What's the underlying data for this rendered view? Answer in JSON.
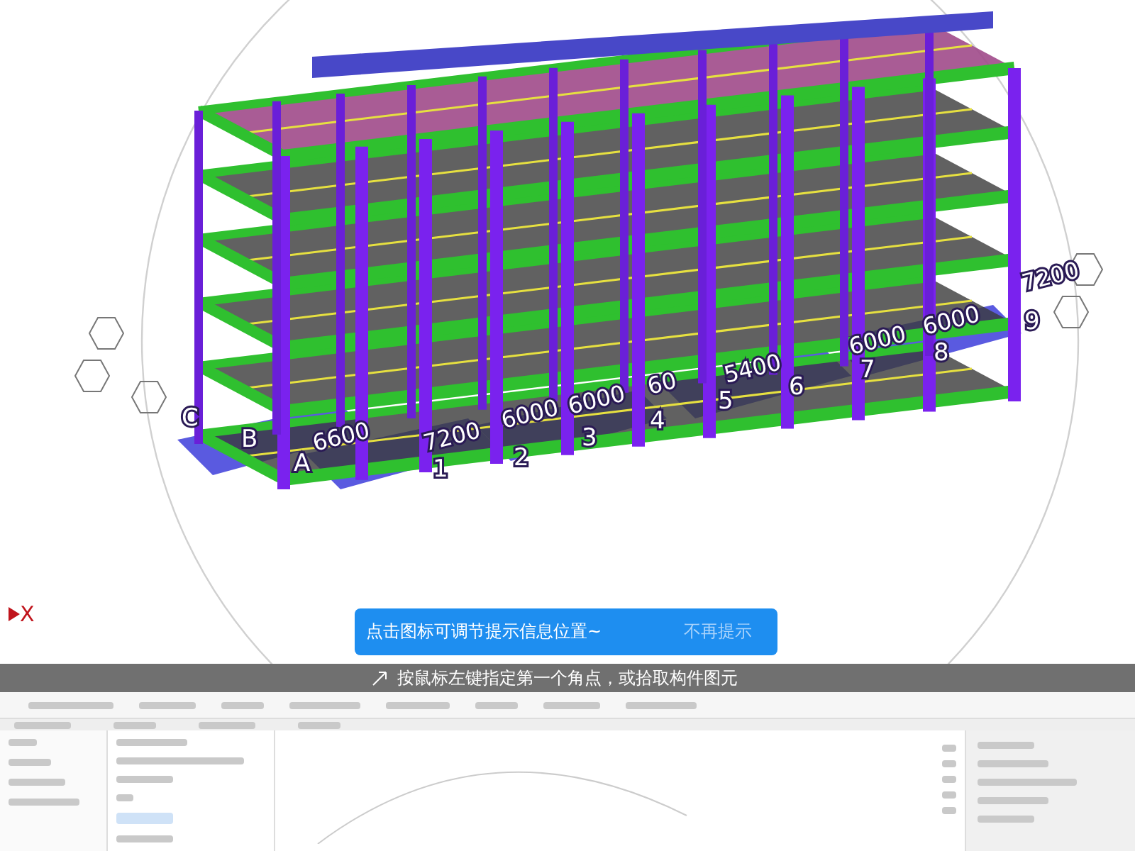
{
  "viewport": {
    "axis_indicator": "X",
    "axis_labels": [
      {
        "kind": "dimension",
        "text": "7200"
      },
      {
        "kind": "dimension",
        "text": "6000"
      },
      {
        "kind": "dimension",
        "text": "6000"
      },
      {
        "kind": "dimension",
        "text": "60"
      },
      {
        "kind": "dimension",
        "text": "5400"
      },
      {
        "kind": "dimension",
        "text": "6000"
      },
      {
        "kind": "dimension",
        "text": "6000"
      },
      {
        "kind": "dimension",
        "text": "7200"
      },
      {
        "kind": "grid",
        "text": "1"
      },
      {
        "kind": "grid",
        "text": "2"
      },
      {
        "kind": "grid",
        "text": "3"
      },
      {
        "kind": "grid",
        "text": "4"
      },
      {
        "kind": "grid",
        "text": "5"
      },
      {
        "kind": "grid",
        "text": "6"
      },
      {
        "kind": "grid",
        "text": "7"
      },
      {
        "kind": "grid",
        "text": "8"
      },
      {
        "kind": "grid",
        "text": "9"
      },
      {
        "kind": "grid",
        "text": "A"
      },
      {
        "kind": "grid",
        "text": "B"
      },
      {
        "kind": "grid",
        "text": "C"
      },
      {
        "kind": "dimension",
        "text": "6600"
      }
    ]
  },
  "tooltip": {
    "message": "点击图标可调节提示信息位置~",
    "dismiss": "不再提示"
  },
  "status_bar": {
    "text": "按鼠标左键指定第一个角点，或拾取构件图元"
  }
}
